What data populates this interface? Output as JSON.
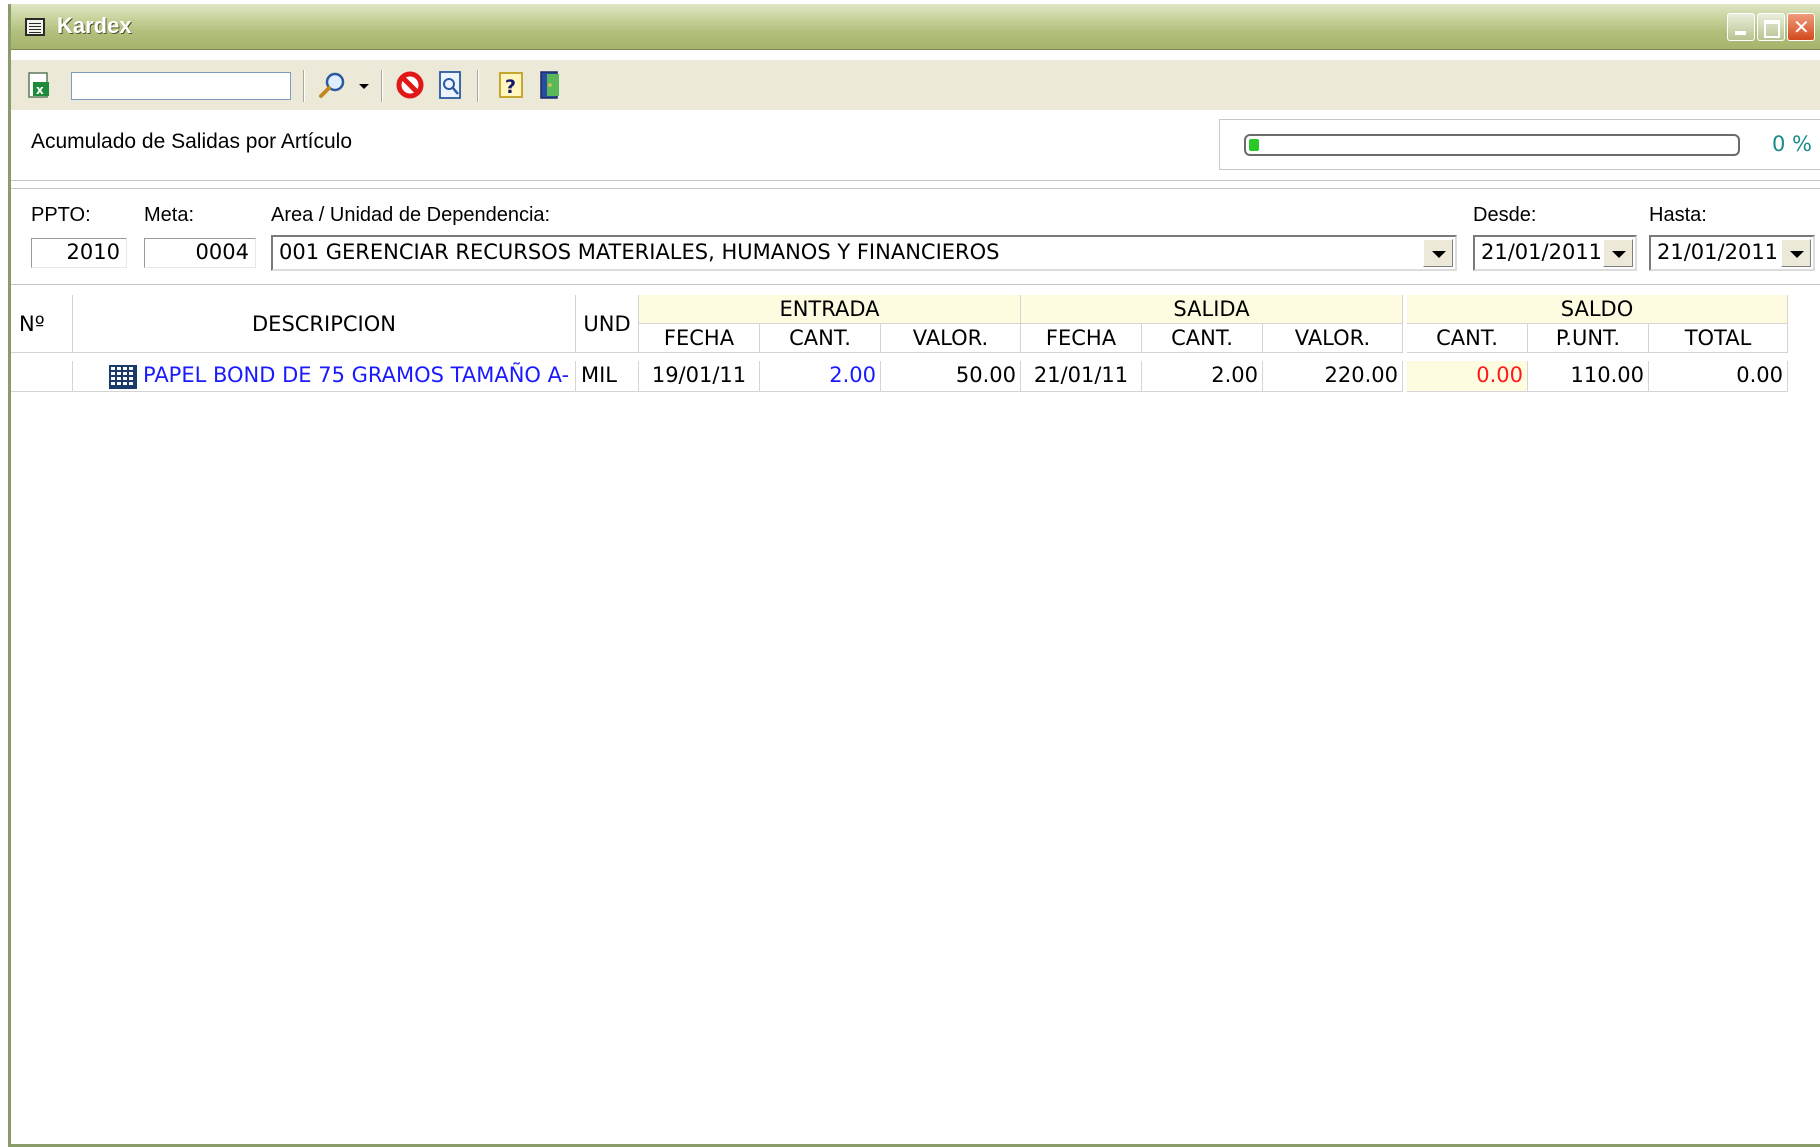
{
  "window": {
    "title": "Kardex"
  },
  "toolbar": {
    "search_value": "",
    "icons": [
      "excel-export-icon",
      "search-icon",
      "dropdown-arrow-icon",
      "cancel-icon",
      "preview-icon",
      "help-icon",
      "exit-icon"
    ]
  },
  "report": {
    "title": "Acumulado de Salidas por Artículo"
  },
  "progress": {
    "label": "0 %",
    "percent": 0.02
  },
  "filters": {
    "ppto_label": "PPTO:",
    "ppto_value": "2010",
    "meta_label": "Meta:",
    "meta_value": "0004",
    "area_label": "Area / Unidad de Dependencia:",
    "area_value": "001 GERENCIAR RECURSOS MATERIALES, HUMANOS Y FINANCIEROS",
    "desde_label": "Desde:",
    "desde_value": "21/01/2011",
    "hasta_label": "Hasta:",
    "hasta_value": "21/01/2011"
  },
  "grid": {
    "headers": {
      "no": "Nº",
      "descripcion": "DESCRIPCION",
      "und": "UND",
      "entrada": "ENTRADA",
      "salida": "SALIDA",
      "saldo": "SALDO",
      "fecha": "FECHA",
      "cant": "CANT.",
      "valor": "VALOR.",
      "punt": "P.UNT.",
      "total": "TOTAL"
    },
    "rows": [
      {
        "no": "",
        "descripcion": "PAPEL BOND DE 75 GRAMOS TAMAÑO A-",
        "und": "MIL",
        "entrada_fecha": "19/01/11",
        "entrada_cant": "2.00",
        "entrada_valor": "50.00",
        "salida_fecha": "21/01/11",
        "salida_cant": "2.00",
        "salida_valor": "220.00",
        "saldo_cant": "0.00",
        "saldo_punt": "110.00",
        "saldo_total": "0.00"
      }
    ]
  },
  "colors": {
    "titlebar": "#b3c07e",
    "link_blue": "#1a1aff",
    "negative_red": "#ff1a1a",
    "group_header_bg": "#fdfbe0",
    "progress_fill": "#28c828"
  }
}
